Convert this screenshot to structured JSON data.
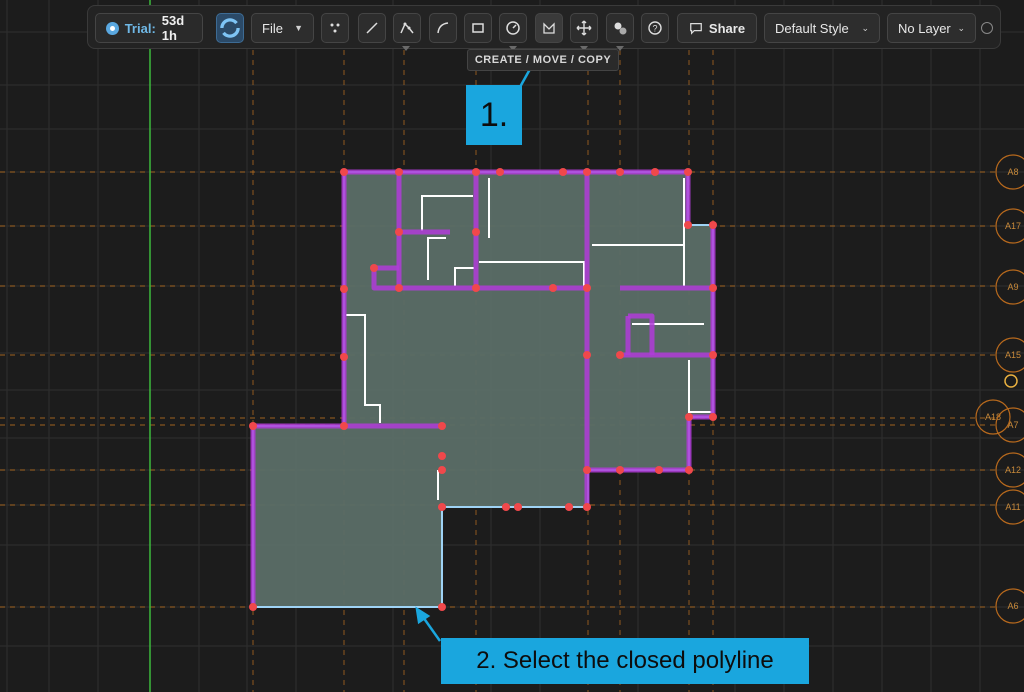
{
  "toolbar": {
    "trial_label": "Trial:",
    "trial_value": "53d 1h",
    "file_label": "File",
    "share_label": "Share",
    "style_value": "Default Style",
    "layer_value": "No Layer",
    "tooltip": "CREATE / MOVE / COPY",
    "icons": [
      "points-icon",
      "line-icon",
      "polyline-icon",
      "arc-icon",
      "rectangle-icon",
      "measure-icon",
      "create-move-copy-icon",
      "move-icon",
      "group-icon",
      "help-icon"
    ]
  },
  "annotations": {
    "step1": "1.",
    "step2": "2. Select the closed polyline"
  },
  "grid_labels": [
    "A8",
    "A17",
    "A9",
    "A15",
    "A18",
    "A7",
    "A12",
    "A11",
    "A6"
  ],
  "colors": {
    "background": "#1c1c1c",
    "grid_line": "#2e2e2e",
    "axis_green": "#3dba3d",
    "guide_orange": "#c0741f",
    "selection_purple": "#b03cd8",
    "vertex_red": "#f0484b",
    "fill": "#5b6e67",
    "annotation_blue": "#1aa6de"
  }
}
